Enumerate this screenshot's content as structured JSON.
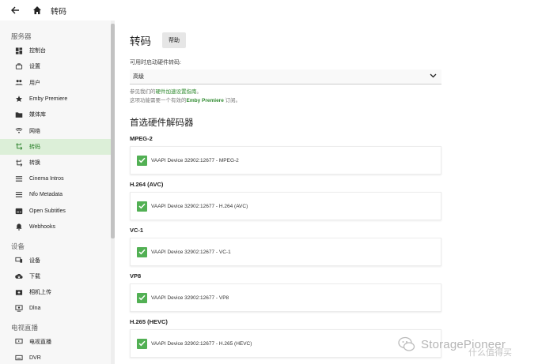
{
  "header": {
    "title": "转码",
    "back_icon": "arrow-left-icon",
    "home_icon": "home-icon"
  },
  "sidebar": {
    "sections": [
      {
        "label": "服务器",
        "items": [
          {
            "label": "控制台",
            "icon": "dashboard-icon"
          },
          {
            "label": "设置",
            "icon": "settings-icon"
          },
          {
            "label": "用户",
            "icon": "users-icon"
          },
          {
            "label": "Emby Premiere",
            "icon": "star-icon"
          },
          {
            "label": "媒体库",
            "icon": "folder-icon"
          },
          {
            "label": "网络",
            "icon": "wifi-icon"
          },
          {
            "label": "转码",
            "icon": "transcode-icon",
            "active": true
          },
          {
            "label": "转换",
            "icon": "convert-icon"
          },
          {
            "label": "Cinema Intros",
            "icon": "list-icon"
          },
          {
            "label": "Nfo Metadata",
            "icon": "list-icon"
          },
          {
            "label": "Open Subtitles",
            "icon": "subtitles-icon"
          },
          {
            "label": "Webhooks",
            "icon": "bell-icon"
          }
        ]
      },
      {
        "label": "设备",
        "items": [
          {
            "label": "设备",
            "icon": "devices-icon"
          },
          {
            "label": "下载",
            "icon": "download-icon"
          },
          {
            "label": "相机上传",
            "icon": "camera-upload-icon"
          },
          {
            "label": "Dlna",
            "icon": "cast-icon"
          }
        ]
      },
      {
        "label": "电视直播",
        "items": [
          {
            "label": "电视直播",
            "icon": "tv-icon"
          },
          {
            "label": "DVR",
            "icon": "dvr-icon"
          }
        ]
      }
    ]
  },
  "main": {
    "title": "转码",
    "help_label": "帮助",
    "hw_label": "可用时启动硬件转码:",
    "hw_value": "高级",
    "hint1_pre": "参见我们的",
    "hint1_link": "硬件加速设置指南",
    "hint1_post": "。",
    "hint2_pre": "这项功能需要一个有效的",
    "hint2_link": "Emby Premiere",
    "hint2_post": " 订阅。",
    "decoders_title": "首选硬件解码器",
    "decoders": [
      {
        "codec": "MPEG-2",
        "device": "VAAPI Device 32902:12677 - MPEG-2",
        "checked": true
      },
      {
        "codec": "H.264 (AVC)",
        "device": "VAAPI Device 32902:12677 - H.264 (AVC)",
        "checked": true
      },
      {
        "codec": "VC-1",
        "device": "VAAPI Device 32902:12677 - VC-1",
        "checked": true
      },
      {
        "codec": "VP8",
        "device": "VAAPI Device 32902:12677 - VP8",
        "checked": true
      },
      {
        "codec": "H.265 (HEVC)",
        "device": "VAAPI Device 32902:12677 - H.265 (HEVC)",
        "checked": true
      }
    ]
  },
  "watermark": {
    "text": "StoragePioneer",
    "sub": "什么值得买"
  },
  "colors": {
    "accent": "#52b054",
    "active_bg": "#dcefd8",
    "sidebar_bg": "#f7f7f7"
  }
}
